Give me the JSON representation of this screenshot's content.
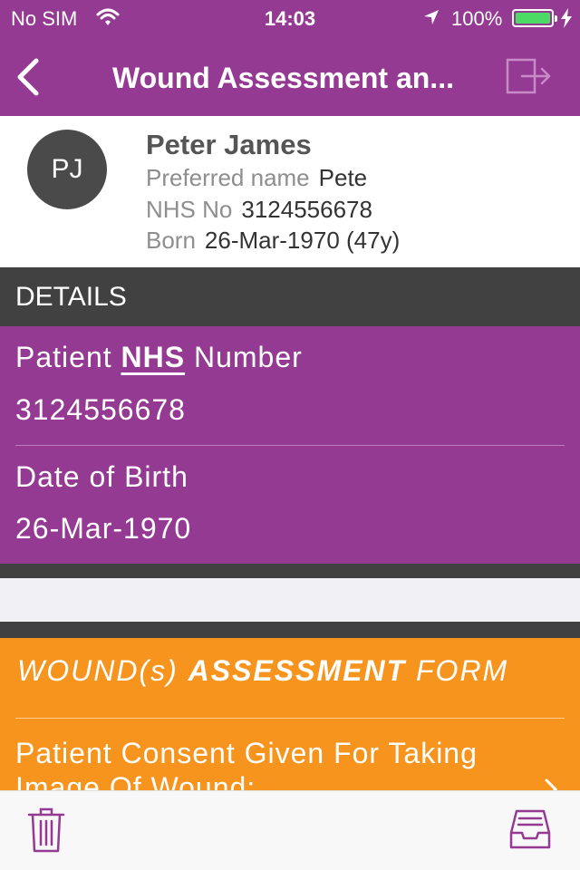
{
  "status_bar": {
    "carrier": "No SIM",
    "time": "14:03",
    "battery_percent": "100%"
  },
  "nav": {
    "title": "Wound Assessment an...",
    "back_icon": "chevron-left-icon",
    "logout_icon": "logout-icon"
  },
  "patient": {
    "initials": "PJ",
    "name": "Peter James",
    "preferred_label": "Preferred name",
    "preferred_value": "Pete",
    "nhs_label": "NHS No",
    "nhs_value": "3124556678",
    "born_label": "Born",
    "born_value": "26-Mar-1970 (47y)"
  },
  "details": {
    "header": "DETAILS",
    "nhs_label_prefix": "Patient",
    "nhs_label_bold": "NHS",
    "nhs_label_suffix": "Number",
    "nhs_value": "3124556678",
    "dob_label": "Date of Birth",
    "dob_value": "26-Mar-1970"
  },
  "form": {
    "title_prefix": "WOUND(s)",
    "title_bold": "ASSESSMENT",
    "title_suffix": "FORM",
    "consent_label": "Patient Consent Given For Taking Image Of Wound:"
  },
  "colors": {
    "primary_purple": "#943a93",
    "dark_band": "#414141",
    "orange": "#f7941d",
    "battery_green": "#4cd964"
  },
  "toolbar": {
    "delete_icon": "trash-icon",
    "archive_icon": "inbox-tray-icon"
  }
}
